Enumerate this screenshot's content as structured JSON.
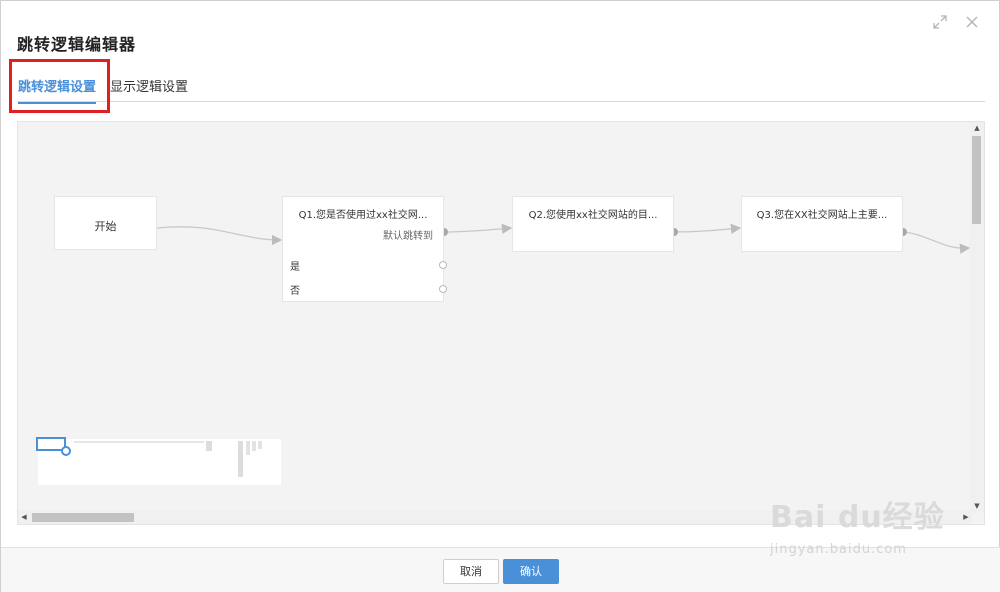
{
  "dialog": {
    "title": "跳转逻辑编辑器",
    "expand_icon": "expand-icon",
    "close_icon": "close-icon"
  },
  "tabs": [
    {
      "label": "跳转逻辑设置",
      "active": true
    },
    {
      "label": "显示逻辑设置",
      "active": false
    }
  ],
  "flow": {
    "start_label": "开始",
    "q1": {
      "title": "Q1.您是否使用过xx社交网...",
      "default_jump": "默认跳转到",
      "options": [
        "是",
        "否"
      ]
    },
    "q2": {
      "title": "Q2.您使用xx社交网站的目..."
    },
    "q3": {
      "title": "Q3.您在XX社交网站上主要..."
    }
  },
  "footer": {
    "cancel_label": "取消",
    "confirm_label": "确认"
  },
  "watermark": {
    "brand": "Bai du经验",
    "url": "jingyan.baidu.com"
  },
  "colors": {
    "accent": "#4a90d9",
    "highlight_box": "#e02020",
    "canvas_bg": "#f3f3f3"
  }
}
